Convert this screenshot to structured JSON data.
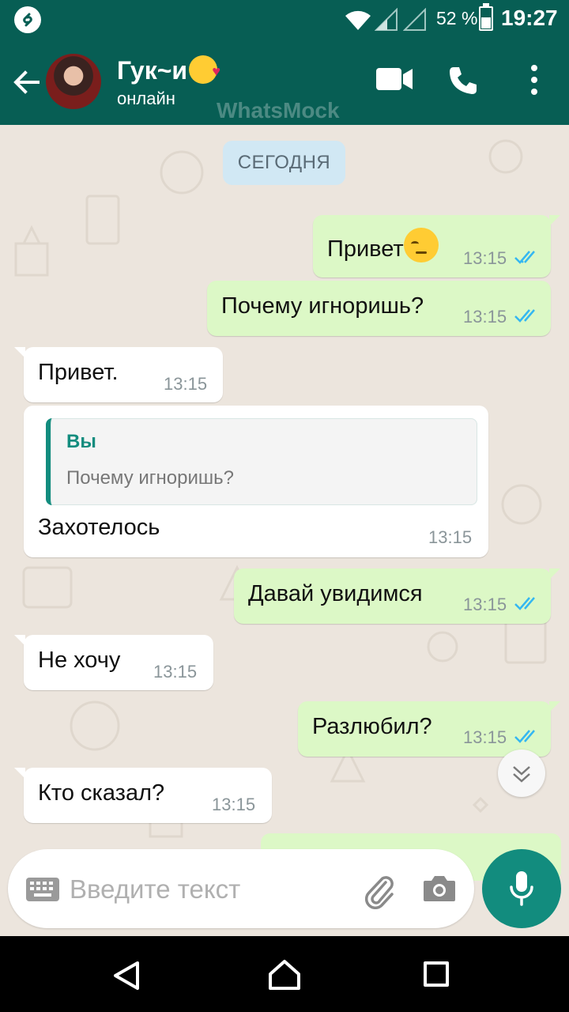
{
  "status_bar": {
    "battery_percent": "52 %",
    "time": "19:27"
  },
  "header": {
    "contact_name": "Гук~и",
    "contact_status": "онлайн",
    "watermark": "WhatsMock"
  },
  "chat": {
    "date_label": "СЕГОДНЯ",
    "messages": [
      {
        "direction": "out",
        "text": "Привет",
        "time": "13:15",
        "read": true
      },
      {
        "direction": "out",
        "text": "Почему игноришь?",
        "time": "13:15",
        "read": true
      },
      {
        "direction": "in",
        "text": "Привет.",
        "time": "13:15"
      },
      {
        "direction": "in",
        "reply_to": {
          "author": "Вы",
          "text": "Почему игноришь?"
        },
        "text": "Захотелось",
        "time": "13:15"
      },
      {
        "direction": "out",
        "text": "Давай увидимся",
        "time": "13:15",
        "read": true
      },
      {
        "direction": "in",
        "text": "Не хочу",
        "time": "13:15"
      },
      {
        "direction": "out",
        "text": "Разлюбил?",
        "time": "13:15",
        "read": true
      },
      {
        "direction": "in",
        "text": "Кто сказал?",
        "time": "13:15"
      }
    ]
  },
  "input": {
    "placeholder": "Введите текст"
  },
  "colors": {
    "header": "#075e54",
    "accent": "#128c7e",
    "outgoing_bubble": "#dcf8c6",
    "incoming_bubble": "#ffffff",
    "read_ticks": "#34b7f1",
    "chat_background": "#ece5dd"
  },
  "icons": [
    "shazam-icon",
    "wifi-icon",
    "signal-icon",
    "battery-icon",
    "back-arrow-icon",
    "video-call-icon",
    "phone-icon",
    "more-vert-icon",
    "double-check-icon",
    "chevron-double-down-icon",
    "keyboard-icon",
    "paperclip-icon",
    "camera-icon",
    "mic-icon",
    "nav-back-icon",
    "nav-home-icon",
    "nav-recent-icon"
  ]
}
